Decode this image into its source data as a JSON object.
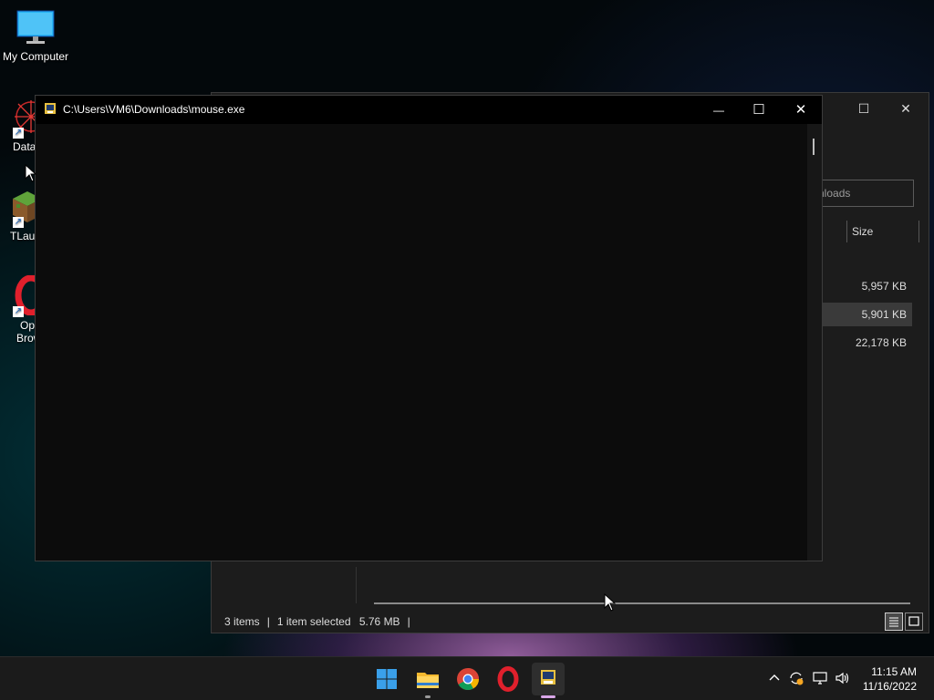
{
  "desktop": {
    "icons": [
      {
        "label": "My Computer"
      },
      {
        "label": "DataW"
      },
      {
        "label": "TLaun"
      },
      {
        "label_line1": "Op",
        "label_line2": "Brow"
      }
    ]
  },
  "explorer": {
    "search_placeholder_fragment": "vnloads",
    "columns": {
      "size": "Size"
    },
    "rows": [
      {
        "size": "5,957 KB",
        "selected": false
      },
      {
        "size": "5,901 KB",
        "selected": true
      },
      {
        "size": "22,178 KB",
        "selected": false
      }
    ],
    "status": {
      "items": "3 items",
      "selected": "1 item selected",
      "selected_size": "5.76 MB"
    }
  },
  "console": {
    "title": "C:\\Users\\VM6\\Downloads\\mouse.exe",
    "buttons": {
      "minimize": "—",
      "maximize": "☐",
      "close": "✕"
    }
  },
  "taskbar": {
    "apps": [
      {
        "name": "start-button"
      },
      {
        "name": "file-explorer"
      },
      {
        "name": "chrome"
      },
      {
        "name": "opera"
      },
      {
        "name": "mouse-exe"
      }
    ],
    "tray": {
      "chevron": "^"
    },
    "clock": {
      "time": "11:15 AM",
      "date": "11/16/2022"
    }
  },
  "colors": {
    "console_bg": "#0c0c0c",
    "explorer_bg": "#1c1c1c",
    "taskbar_bg": "#1b1b1b",
    "accent_blue": "#0078d4",
    "opera_red": "#e0202c"
  }
}
